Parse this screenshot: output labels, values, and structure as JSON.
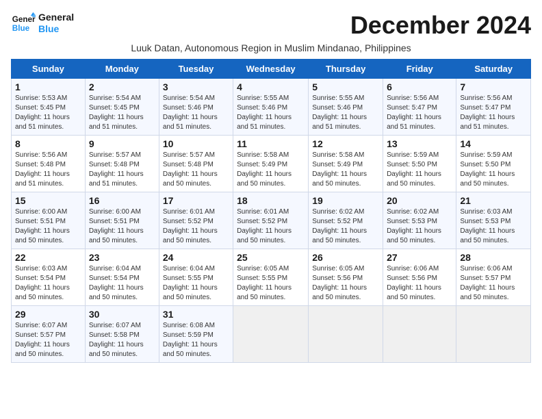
{
  "header": {
    "logo_line1": "General",
    "logo_line2": "Blue",
    "month_title": "December 2024",
    "subtitle": "Luuk Datan, Autonomous Region in Muslim Mindanao, Philippines"
  },
  "days_of_week": [
    "Sunday",
    "Monday",
    "Tuesday",
    "Wednesday",
    "Thursday",
    "Friday",
    "Saturday"
  ],
  "weeks": [
    [
      {
        "day": "1",
        "rise": "5:53 AM",
        "set": "5:45 PM",
        "daylight": "11 hours and 51 minutes."
      },
      {
        "day": "2",
        "rise": "5:54 AM",
        "set": "5:45 PM",
        "daylight": "11 hours and 51 minutes."
      },
      {
        "day": "3",
        "rise": "5:54 AM",
        "set": "5:46 PM",
        "daylight": "11 hours and 51 minutes."
      },
      {
        "day": "4",
        "rise": "5:55 AM",
        "set": "5:46 PM",
        "daylight": "11 hours and 51 minutes."
      },
      {
        "day": "5",
        "rise": "5:55 AM",
        "set": "5:46 PM",
        "daylight": "11 hours and 51 minutes."
      },
      {
        "day": "6",
        "rise": "5:56 AM",
        "set": "5:47 PM",
        "daylight": "11 hours and 51 minutes."
      },
      {
        "day": "7",
        "rise": "5:56 AM",
        "set": "5:47 PM",
        "daylight": "11 hours and 51 minutes."
      }
    ],
    [
      {
        "day": "8",
        "rise": "5:56 AM",
        "set": "5:48 PM",
        "daylight": "11 hours and 51 minutes."
      },
      {
        "day": "9",
        "rise": "5:57 AM",
        "set": "5:48 PM",
        "daylight": "11 hours and 51 minutes."
      },
      {
        "day": "10",
        "rise": "5:57 AM",
        "set": "5:48 PM",
        "daylight": "11 hours and 50 minutes."
      },
      {
        "day": "11",
        "rise": "5:58 AM",
        "set": "5:49 PM",
        "daylight": "11 hours and 50 minutes."
      },
      {
        "day": "12",
        "rise": "5:58 AM",
        "set": "5:49 PM",
        "daylight": "11 hours and 50 minutes."
      },
      {
        "day": "13",
        "rise": "5:59 AM",
        "set": "5:50 PM",
        "daylight": "11 hours and 50 minutes."
      },
      {
        "day": "14",
        "rise": "5:59 AM",
        "set": "5:50 PM",
        "daylight": "11 hours and 50 minutes."
      }
    ],
    [
      {
        "day": "15",
        "rise": "6:00 AM",
        "set": "5:51 PM",
        "daylight": "11 hours and 50 minutes."
      },
      {
        "day": "16",
        "rise": "6:00 AM",
        "set": "5:51 PM",
        "daylight": "11 hours and 50 minutes."
      },
      {
        "day": "17",
        "rise": "6:01 AM",
        "set": "5:52 PM",
        "daylight": "11 hours and 50 minutes."
      },
      {
        "day": "18",
        "rise": "6:01 AM",
        "set": "5:52 PM",
        "daylight": "11 hours and 50 minutes."
      },
      {
        "day": "19",
        "rise": "6:02 AM",
        "set": "5:52 PM",
        "daylight": "11 hours and 50 minutes."
      },
      {
        "day": "20",
        "rise": "6:02 AM",
        "set": "5:53 PM",
        "daylight": "11 hours and 50 minutes."
      },
      {
        "day": "21",
        "rise": "6:03 AM",
        "set": "5:53 PM",
        "daylight": "11 hours and 50 minutes."
      }
    ],
    [
      {
        "day": "22",
        "rise": "6:03 AM",
        "set": "5:54 PM",
        "daylight": "11 hours and 50 minutes."
      },
      {
        "day": "23",
        "rise": "6:04 AM",
        "set": "5:54 PM",
        "daylight": "11 hours and 50 minutes."
      },
      {
        "day": "24",
        "rise": "6:04 AM",
        "set": "5:55 PM",
        "daylight": "11 hours and 50 minutes."
      },
      {
        "day": "25",
        "rise": "6:05 AM",
        "set": "5:55 PM",
        "daylight": "11 hours and 50 minutes."
      },
      {
        "day": "26",
        "rise": "6:05 AM",
        "set": "5:56 PM",
        "daylight": "11 hours and 50 minutes."
      },
      {
        "day": "27",
        "rise": "6:06 AM",
        "set": "5:56 PM",
        "daylight": "11 hours and 50 minutes."
      },
      {
        "day": "28",
        "rise": "6:06 AM",
        "set": "5:57 PM",
        "daylight": "11 hours and 50 minutes."
      }
    ],
    [
      {
        "day": "29",
        "rise": "6:07 AM",
        "set": "5:57 PM",
        "daylight": "11 hours and 50 minutes."
      },
      {
        "day": "30",
        "rise": "6:07 AM",
        "set": "5:58 PM",
        "daylight": "11 hours and 50 minutes."
      },
      {
        "day": "31",
        "rise": "6:08 AM",
        "set": "5:59 PM",
        "daylight": "11 hours and 50 minutes."
      },
      null,
      null,
      null,
      null
    ]
  ],
  "labels": {
    "sunrise": "Sunrise:",
    "sunset": "Sunset:",
    "daylight": "Daylight:"
  }
}
